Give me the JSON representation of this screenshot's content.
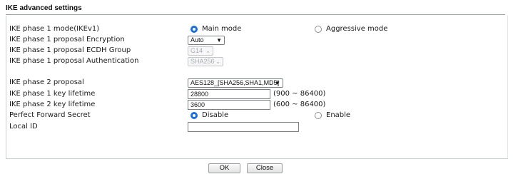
{
  "section_title": "IKE advanced settings",
  "rows": {
    "phase1_mode": {
      "label": "IKE phase 1 mode(IKEv1)",
      "options": [
        "Main mode",
        "Aggressive mode"
      ],
      "selected": "Main mode"
    },
    "phase1_encryption": {
      "label": "IKE phase 1 proposal Encryption",
      "value": "Auto"
    },
    "phase1_ecdh": {
      "label": "IKE phase 1 proposal ECDH Group",
      "value": "G14"
    },
    "phase1_auth": {
      "label": "IKE phase 1 proposal Authentication",
      "value": "SHA256"
    },
    "phase2_proposal": {
      "label": "IKE phase 2 proposal",
      "value": "AES128_[SHA256,SHA1,MD5]"
    },
    "phase1_lifetime": {
      "label": "IKE phase 1 key lifetime",
      "value": "28800",
      "range": "(900 ~ 86400)"
    },
    "phase2_lifetime": {
      "label": "IKE phase 2 key lifetime",
      "value": "3600",
      "range": "(600 ~ 86400)"
    },
    "pfs": {
      "label": "Perfect Forward Secret",
      "options": [
        "Disable",
        "Enable"
      ],
      "selected": "Disable"
    },
    "local_id": {
      "label": "Local ID",
      "value": ""
    }
  },
  "buttons": {
    "ok": "OK",
    "close": "Close"
  },
  "colors": {
    "radio_selected": "#1a6fe0"
  }
}
